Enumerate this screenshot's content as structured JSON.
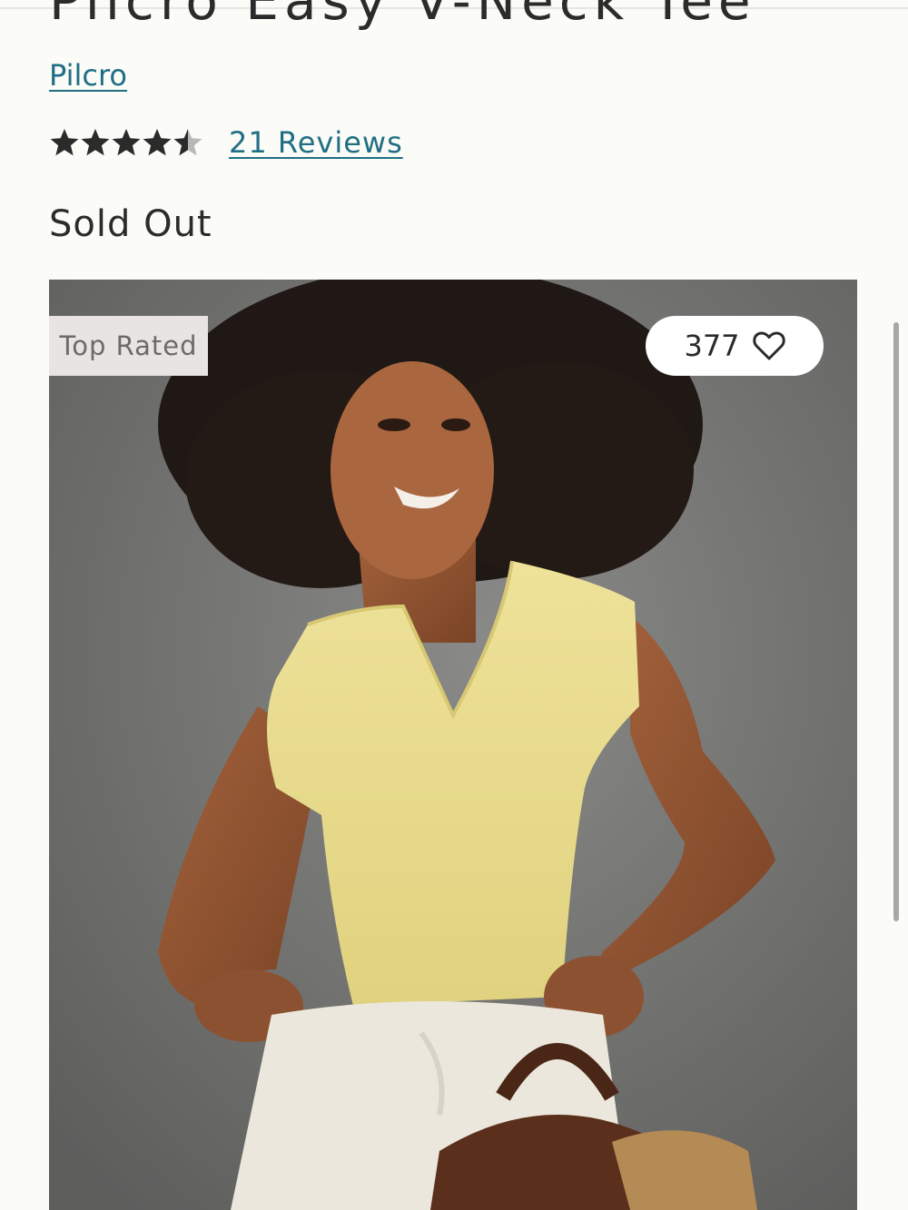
{
  "product": {
    "title": "Pilcro Easy V-Neck Tee",
    "brand": "Pilcro",
    "rating": 4.5,
    "rating_max": 5,
    "reviews_label": "21 Reviews",
    "status": "Sold Out"
  },
  "image": {
    "badge": "Top Rated",
    "wishlist_count": "377",
    "wishlist_icon": "heart-outline-icon",
    "star_icon": "star-icon"
  },
  "colors": {
    "link": "#1f6f84",
    "text": "#2b2b2b",
    "background": "#fbfbf7",
    "badge_bg": "#e8e4e2"
  }
}
